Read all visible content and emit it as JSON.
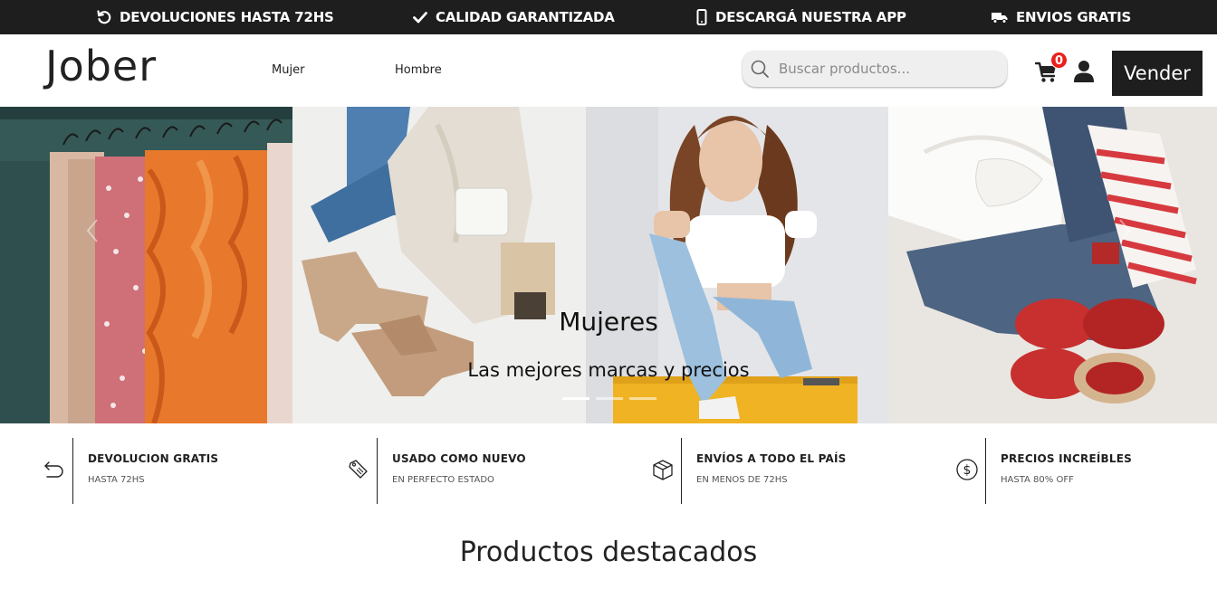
{
  "topbar": {
    "items": [
      {
        "icon": "return-arrow-icon",
        "label": "DEVOLUCIONES HASTA 72HS"
      },
      {
        "icon": "checkmark-icon",
        "label": "CALIDAD GARANTIZADA"
      },
      {
        "icon": "mobile-phone-icon",
        "label": "DESCARGÁ NUESTRA APP"
      },
      {
        "icon": "truck-icon",
        "label": "ENVIOS GRATIS"
      }
    ]
  },
  "header": {
    "logo": "Jober",
    "nav": [
      {
        "label": "Mujer"
      },
      {
        "label": "Hombre"
      }
    ],
    "search": {
      "placeholder": "Buscar productos...",
      "value": ""
    },
    "cart_count": "0",
    "sell_label": "Vender"
  },
  "hero": {
    "title": "Mujeres",
    "subtitle": "Las mejores marcas y precios",
    "slides": 3,
    "active_slide": 1
  },
  "features": [
    {
      "icon": "return-arrow-icon",
      "title": "DEVOLUCION GRATIS",
      "subtitle": "HASTA 72HS"
    },
    {
      "icon": "price-tag-icon",
      "title": "USADO COMO NUEVO",
      "subtitle": "EN PERFECTO ESTADO"
    },
    {
      "icon": "package-box-icon",
      "title": "ENVÍOS A TODO EL PAÍS",
      "subtitle": "EN MENOS DE 72HS"
    },
    {
      "icon": "dollar-coin-icon",
      "title": "PRECIOS INCREÍBLES",
      "subtitle": "HASTA 80% OFF"
    }
  ],
  "section": {
    "title": "Productos destacados"
  },
  "colors": {
    "dark": "#1e1e1e",
    "badge": "#e8211b",
    "search_bg": "#efefef"
  }
}
